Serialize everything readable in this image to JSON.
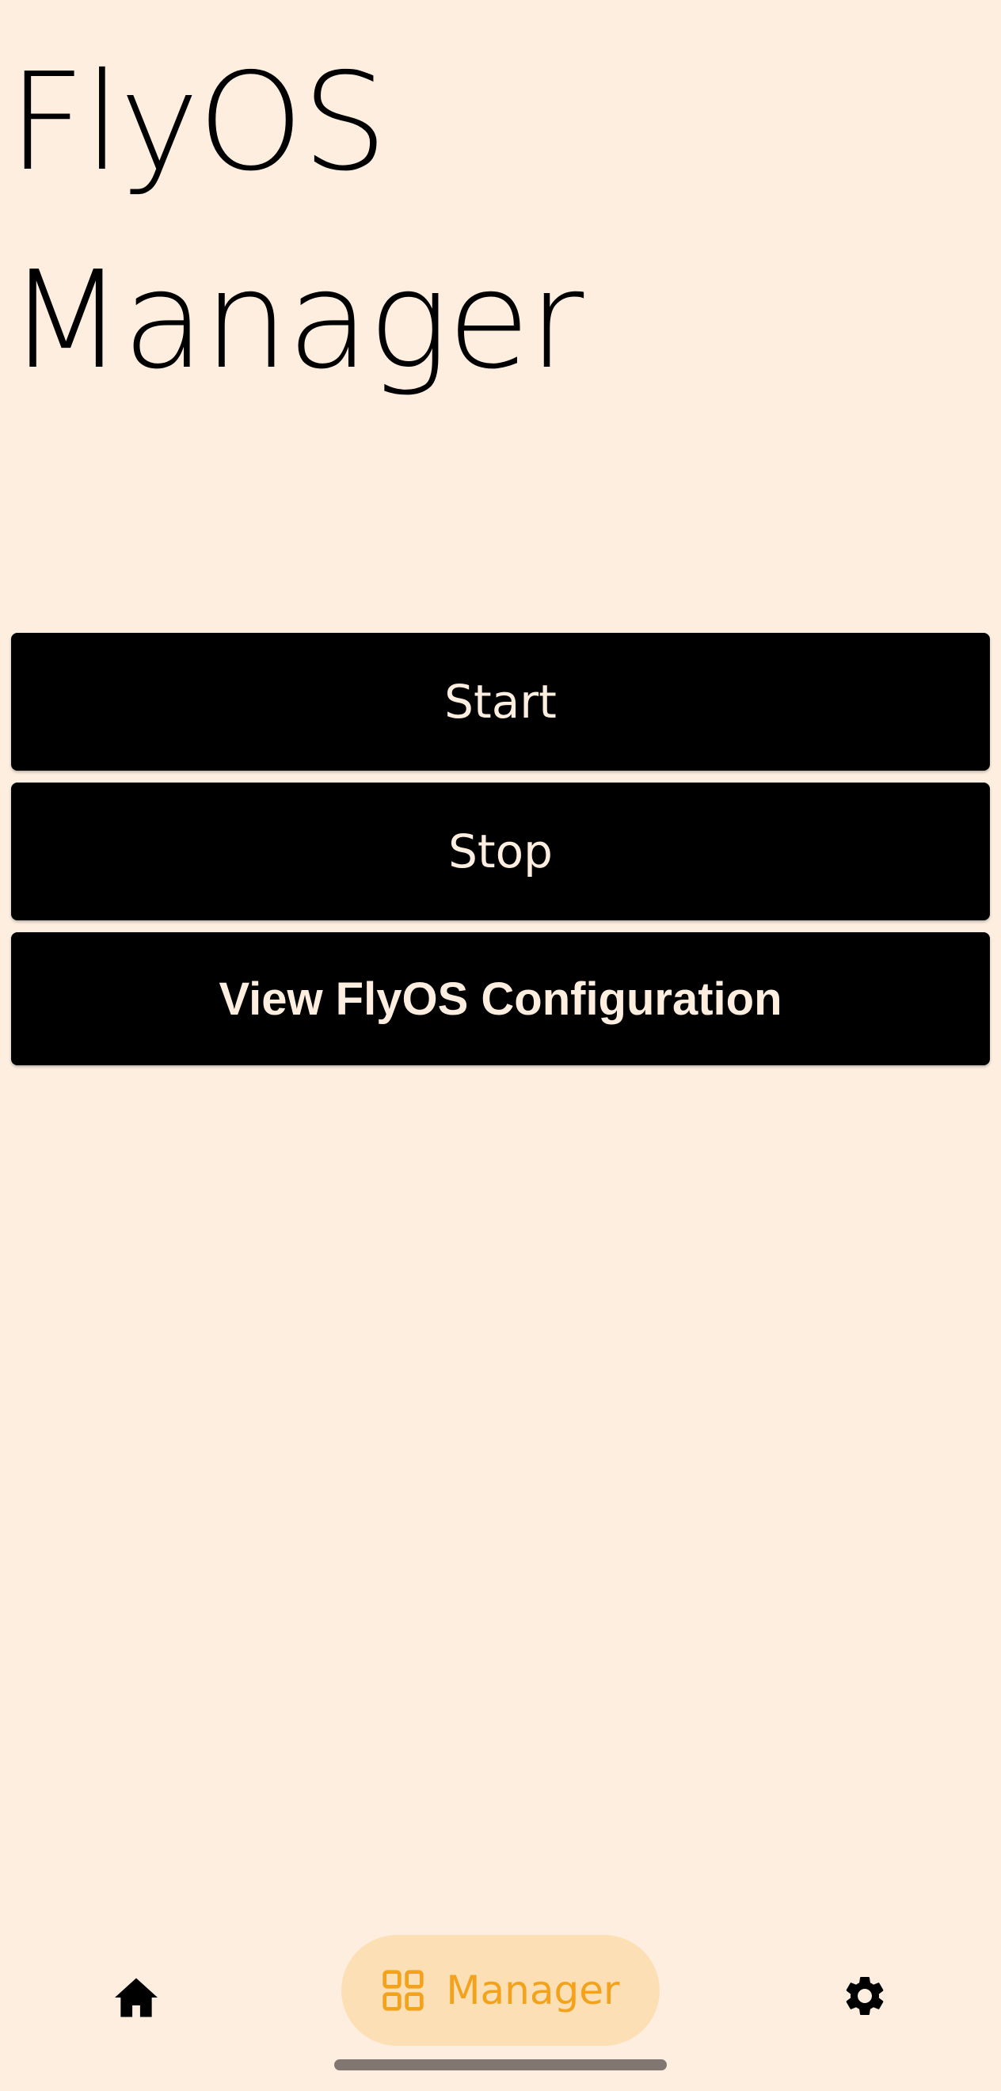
{
  "header": {
    "title_line1": "FlyOS",
    "title_line2": "Manager"
  },
  "actions": {
    "start_label": "Start",
    "stop_label": "Stop",
    "config_label": "View FlyOS Configuration"
  },
  "bottom_nav": {
    "items": [
      {
        "id": "home",
        "icon": "home-icon",
        "label": "",
        "selected": false
      },
      {
        "id": "manager",
        "icon": "grid-icon",
        "label": "Manager",
        "selected": true
      },
      {
        "id": "settings",
        "icon": "gear-icon",
        "label": "",
        "selected": false
      }
    ]
  },
  "colors": {
    "background": "#FDEEE0",
    "button_bg": "#000000",
    "button_text": "#FDEEE0",
    "accent": "#F2A21B",
    "nav_pill": "#FDDFB5"
  }
}
